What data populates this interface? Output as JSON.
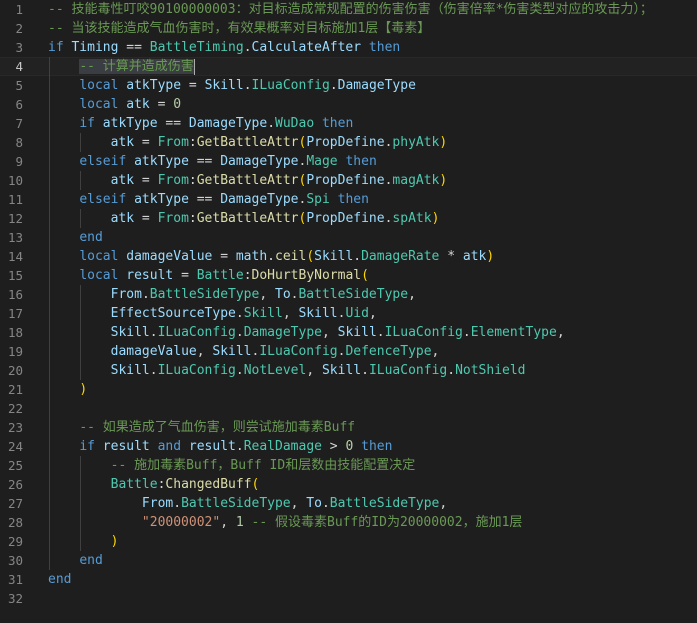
{
  "editor": {
    "current_line": 4,
    "lines": [
      {
        "n": "1",
        "tokens": [
          {
            "t": "-- 技能毒性叮咬90100000003：对目标造成常规配置的伤害伤害（伤害倍率*伤害类型对应的攻击力）；",
            "c": "cm"
          }
        ]
      },
      {
        "n": "2",
        "tokens": [
          {
            "t": "-- 当该技能造成气血伤害时，有效果概率对目标施加1层【毒素】",
            "c": "cm"
          }
        ]
      },
      {
        "n": "3",
        "tokens": [
          {
            "t": "if",
            "c": "kw"
          },
          {
            "t": " "
          },
          {
            "t": "Timing",
            "c": "var"
          },
          {
            "t": " == "
          },
          {
            "t": "BattleTiming",
            "c": "cls"
          },
          {
            "t": "."
          },
          {
            "t": "CalculateAfter",
            "c": "var"
          },
          {
            "t": " "
          },
          {
            "t": "then",
            "c": "kw"
          }
        ]
      },
      {
        "n": "4",
        "tokens": [
          {
            "t": "    "
          },
          {
            "t": "-- 计算并造成伤害",
            "c": "cm",
            "sel": true
          }
        ]
      },
      {
        "n": "5",
        "tokens": [
          {
            "t": "    "
          },
          {
            "t": "local",
            "c": "kw"
          },
          {
            "t": " "
          },
          {
            "t": "atkType",
            "c": "var"
          },
          {
            "t": " = "
          },
          {
            "t": "Skill",
            "c": "var"
          },
          {
            "t": "."
          },
          {
            "t": "ILuaConfig",
            "c": "cls"
          },
          {
            "t": "."
          },
          {
            "t": "DamageType",
            "c": "var"
          }
        ]
      },
      {
        "n": "6",
        "tokens": [
          {
            "t": "    "
          },
          {
            "t": "local",
            "c": "kw"
          },
          {
            "t": " "
          },
          {
            "t": "atk",
            "c": "var"
          },
          {
            "t": " = "
          },
          {
            "t": "0",
            "c": "num"
          }
        ]
      },
      {
        "n": "7",
        "tokens": [
          {
            "t": "    "
          },
          {
            "t": "if",
            "c": "kw"
          },
          {
            "t": " "
          },
          {
            "t": "atkType",
            "c": "var"
          },
          {
            "t": " == "
          },
          {
            "t": "DamageType",
            "c": "var"
          },
          {
            "t": "."
          },
          {
            "t": "WuDao",
            "c": "cls"
          },
          {
            "t": " "
          },
          {
            "t": "then",
            "c": "kw"
          }
        ]
      },
      {
        "n": "8",
        "tokens": [
          {
            "t": "        "
          },
          {
            "t": "atk",
            "c": "var"
          },
          {
            "t": " = "
          },
          {
            "t": "From",
            "c": "cls"
          },
          {
            "t": ":"
          },
          {
            "t": "GetBattleAttr",
            "c": "fn"
          },
          {
            "t": "(",
            "c": "paren1"
          },
          {
            "t": "PropDefine",
            "c": "var"
          },
          {
            "t": "."
          },
          {
            "t": "phyAtk",
            "c": "cls"
          },
          {
            "t": ")",
            "c": "paren1"
          }
        ]
      },
      {
        "n": "9",
        "tokens": [
          {
            "t": "    "
          },
          {
            "t": "elseif",
            "c": "kw"
          },
          {
            "t": " "
          },
          {
            "t": "atkType",
            "c": "var"
          },
          {
            "t": " == "
          },
          {
            "t": "DamageType",
            "c": "var"
          },
          {
            "t": "."
          },
          {
            "t": "Mage",
            "c": "cls"
          },
          {
            "t": " "
          },
          {
            "t": "then",
            "c": "kw"
          }
        ]
      },
      {
        "n": "10",
        "tokens": [
          {
            "t": "        "
          },
          {
            "t": "atk",
            "c": "var"
          },
          {
            "t": " = "
          },
          {
            "t": "From",
            "c": "cls"
          },
          {
            "t": ":"
          },
          {
            "t": "GetBattleAttr",
            "c": "fn"
          },
          {
            "t": "(",
            "c": "paren1"
          },
          {
            "t": "PropDefine",
            "c": "var"
          },
          {
            "t": "."
          },
          {
            "t": "magAtk",
            "c": "cls"
          },
          {
            "t": ")",
            "c": "paren1"
          }
        ]
      },
      {
        "n": "11",
        "tokens": [
          {
            "t": "    "
          },
          {
            "t": "elseif",
            "c": "kw"
          },
          {
            "t": " "
          },
          {
            "t": "atkType",
            "c": "var"
          },
          {
            "t": " == "
          },
          {
            "t": "DamageType",
            "c": "var"
          },
          {
            "t": "."
          },
          {
            "t": "Spi",
            "c": "cls"
          },
          {
            "t": " "
          },
          {
            "t": "then",
            "c": "kw"
          }
        ]
      },
      {
        "n": "12",
        "tokens": [
          {
            "t": "        "
          },
          {
            "t": "atk",
            "c": "var"
          },
          {
            "t": " = "
          },
          {
            "t": "From",
            "c": "cls"
          },
          {
            "t": ":"
          },
          {
            "t": "GetBattleAttr",
            "c": "fn"
          },
          {
            "t": "(",
            "c": "paren1"
          },
          {
            "t": "PropDefine",
            "c": "var"
          },
          {
            "t": "."
          },
          {
            "t": "spAtk",
            "c": "cls"
          },
          {
            "t": ")",
            "c": "paren1"
          }
        ]
      },
      {
        "n": "13",
        "tokens": [
          {
            "t": "    "
          },
          {
            "t": "end",
            "c": "kw"
          }
        ]
      },
      {
        "n": "14",
        "tokens": [
          {
            "t": "    "
          },
          {
            "t": "local",
            "c": "kw"
          },
          {
            "t": " "
          },
          {
            "t": "damageValue",
            "c": "var"
          },
          {
            "t": " = "
          },
          {
            "t": "math",
            "c": "var"
          },
          {
            "t": "."
          },
          {
            "t": "ceil",
            "c": "fn"
          },
          {
            "t": "(",
            "c": "paren1"
          },
          {
            "t": "Skill",
            "c": "var"
          },
          {
            "t": "."
          },
          {
            "t": "DamageRate",
            "c": "cls"
          },
          {
            "t": " * "
          },
          {
            "t": "atk",
            "c": "var"
          },
          {
            "t": ")",
            "c": "paren1"
          }
        ]
      },
      {
        "n": "15",
        "tokens": [
          {
            "t": "    "
          },
          {
            "t": "local",
            "c": "kw"
          },
          {
            "t": " "
          },
          {
            "t": "result",
            "c": "var"
          },
          {
            "t": " = "
          },
          {
            "t": "Battle",
            "c": "cls"
          },
          {
            "t": ":"
          },
          {
            "t": "DoHurtByNormal",
            "c": "fn"
          },
          {
            "t": "(",
            "c": "paren1"
          }
        ]
      },
      {
        "n": "16",
        "tokens": [
          {
            "t": "        "
          },
          {
            "t": "From",
            "c": "var"
          },
          {
            "t": "."
          },
          {
            "t": "BattleSideType",
            "c": "cls"
          },
          {
            "t": ", "
          },
          {
            "t": "To",
            "c": "var"
          },
          {
            "t": "."
          },
          {
            "t": "BattleSideType",
            "c": "cls"
          },
          {
            "t": ","
          }
        ]
      },
      {
        "n": "17",
        "tokens": [
          {
            "t": "        "
          },
          {
            "t": "EffectSourceType",
            "c": "var"
          },
          {
            "t": "."
          },
          {
            "t": "Skill",
            "c": "cls"
          },
          {
            "t": ", "
          },
          {
            "t": "Skill",
            "c": "var"
          },
          {
            "t": "."
          },
          {
            "t": "Uid",
            "c": "cls"
          },
          {
            "t": ","
          }
        ]
      },
      {
        "n": "18",
        "tokens": [
          {
            "t": "        "
          },
          {
            "t": "Skill",
            "c": "var"
          },
          {
            "t": "."
          },
          {
            "t": "ILuaConfig",
            "c": "cls"
          },
          {
            "t": "."
          },
          {
            "t": "DamageType",
            "c": "cls"
          },
          {
            "t": ", "
          },
          {
            "t": "Skill",
            "c": "var"
          },
          {
            "t": "."
          },
          {
            "t": "ILuaConfig",
            "c": "cls"
          },
          {
            "t": "."
          },
          {
            "t": "ElementType",
            "c": "cls"
          },
          {
            "t": ","
          }
        ]
      },
      {
        "n": "19",
        "tokens": [
          {
            "t": "        "
          },
          {
            "t": "damageValue",
            "c": "var"
          },
          {
            "t": ", "
          },
          {
            "t": "Skill",
            "c": "var"
          },
          {
            "t": "."
          },
          {
            "t": "ILuaConfig",
            "c": "cls"
          },
          {
            "t": "."
          },
          {
            "t": "DefenceType",
            "c": "cls"
          },
          {
            "t": ","
          }
        ]
      },
      {
        "n": "20",
        "tokens": [
          {
            "t": "        "
          },
          {
            "t": "Skill",
            "c": "var"
          },
          {
            "t": "."
          },
          {
            "t": "ILuaConfig",
            "c": "cls"
          },
          {
            "t": "."
          },
          {
            "t": "NotLevel",
            "c": "cls"
          },
          {
            "t": ", "
          },
          {
            "t": "Skill",
            "c": "var"
          },
          {
            "t": "."
          },
          {
            "t": "ILuaConfig",
            "c": "cls"
          },
          {
            "t": "."
          },
          {
            "t": "NotShield",
            "c": "cls"
          }
        ]
      },
      {
        "n": "21",
        "tokens": [
          {
            "t": "    "
          },
          {
            "t": ")",
            "c": "paren1"
          }
        ]
      },
      {
        "n": "22",
        "tokens": []
      },
      {
        "n": "23",
        "tokens": [
          {
            "t": "    "
          },
          {
            "t": "-- 如果造成了气血伤害，则尝试施加毒素Buff",
            "c": "cm"
          }
        ]
      },
      {
        "n": "24",
        "tokens": [
          {
            "t": "    "
          },
          {
            "t": "if",
            "c": "kw"
          },
          {
            "t": " "
          },
          {
            "t": "result",
            "c": "var"
          },
          {
            "t": " "
          },
          {
            "t": "and",
            "c": "kw"
          },
          {
            "t": " "
          },
          {
            "t": "result",
            "c": "var"
          },
          {
            "t": "."
          },
          {
            "t": "RealDamage",
            "c": "cls"
          },
          {
            "t": " > "
          },
          {
            "t": "0",
            "c": "num"
          },
          {
            "t": " "
          },
          {
            "t": "then",
            "c": "kw"
          }
        ]
      },
      {
        "n": "25",
        "tokens": [
          {
            "t": "        "
          },
          {
            "t": "-- 施加毒素Buff，Buff ID和层数由技能配置决定",
            "c": "cm"
          }
        ]
      },
      {
        "n": "26",
        "tokens": [
          {
            "t": "        "
          },
          {
            "t": "Battle",
            "c": "cls"
          },
          {
            "t": ":"
          },
          {
            "t": "ChangedBuff",
            "c": "fn"
          },
          {
            "t": "(",
            "c": "paren1"
          }
        ]
      },
      {
        "n": "27",
        "tokens": [
          {
            "t": "            "
          },
          {
            "t": "From",
            "c": "var"
          },
          {
            "t": "."
          },
          {
            "t": "BattleSideType",
            "c": "cls"
          },
          {
            "t": ", "
          },
          {
            "t": "To",
            "c": "var"
          },
          {
            "t": "."
          },
          {
            "t": "BattleSideType",
            "c": "cls"
          },
          {
            "t": ","
          }
        ]
      },
      {
        "n": "28",
        "tokens": [
          {
            "t": "            "
          },
          {
            "t": "\"20000002\"",
            "c": "str"
          },
          {
            "t": ", "
          },
          {
            "t": "1",
            "c": "num"
          },
          {
            "t": " "
          },
          {
            "t": "-- 假设毒素Buff的ID为20000002，施加1层",
            "c": "cm"
          }
        ]
      },
      {
        "n": "29",
        "tokens": [
          {
            "t": "        "
          },
          {
            "t": ")",
            "c": "paren1"
          }
        ]
      },
      {
        "n": "30",
        "tokens": [
          {
            "t": "    "
          },
          {
            "t": "end",
            "c": "kw"
          }
        ]
      },
      {
        "n": "31",
        "tokens": [
          {
            "t": "end",
            "c": "kw"
          }
        ]
      },
      {
        "n": "32",
        "tokens": []
      }
    ]
  },
  "colors": {
    "background": "#1e1e1e",
    "keyword": "#569cd6",
    "variable": "#9cdcfe",
    "type": "#4ec9b0",
    "function": "#dcdcaa",
    "number": "#b5cea8",
    "string": "#ce9178",
    "comment": "#6a9955",
    "line_number": "#858585"
  }
}
